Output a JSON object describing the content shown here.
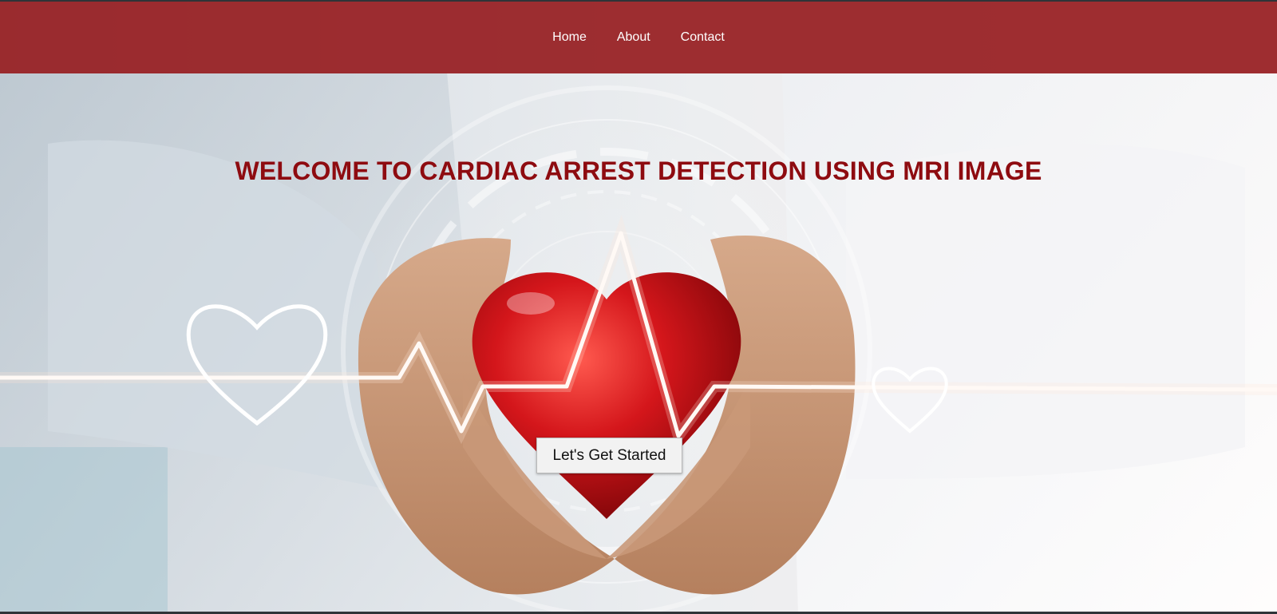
{
  "nav": {
    "items": [
      {
        "label": "Home"
      },
      {
        "label": "About"
      },
      {
        "label": "Contact"
      }
    ]
  },
  "hero": {
    "title": "WELCOME TO CARDIAC ARREST DETECTION USING MRI IMAGE",
    "cta_label": "Let's Get Started"
  },
  "colors": {
    "navbar": "#961c20",
    "title": "#8e0b10",
    "heart": "#d4161b"
  },
  "icons": {
    "left_heart": "heart-outline-icon",
    "right_heart": "heart-outline-icon",
    "ecg": "heartbeat-line-icon"
  }
}
